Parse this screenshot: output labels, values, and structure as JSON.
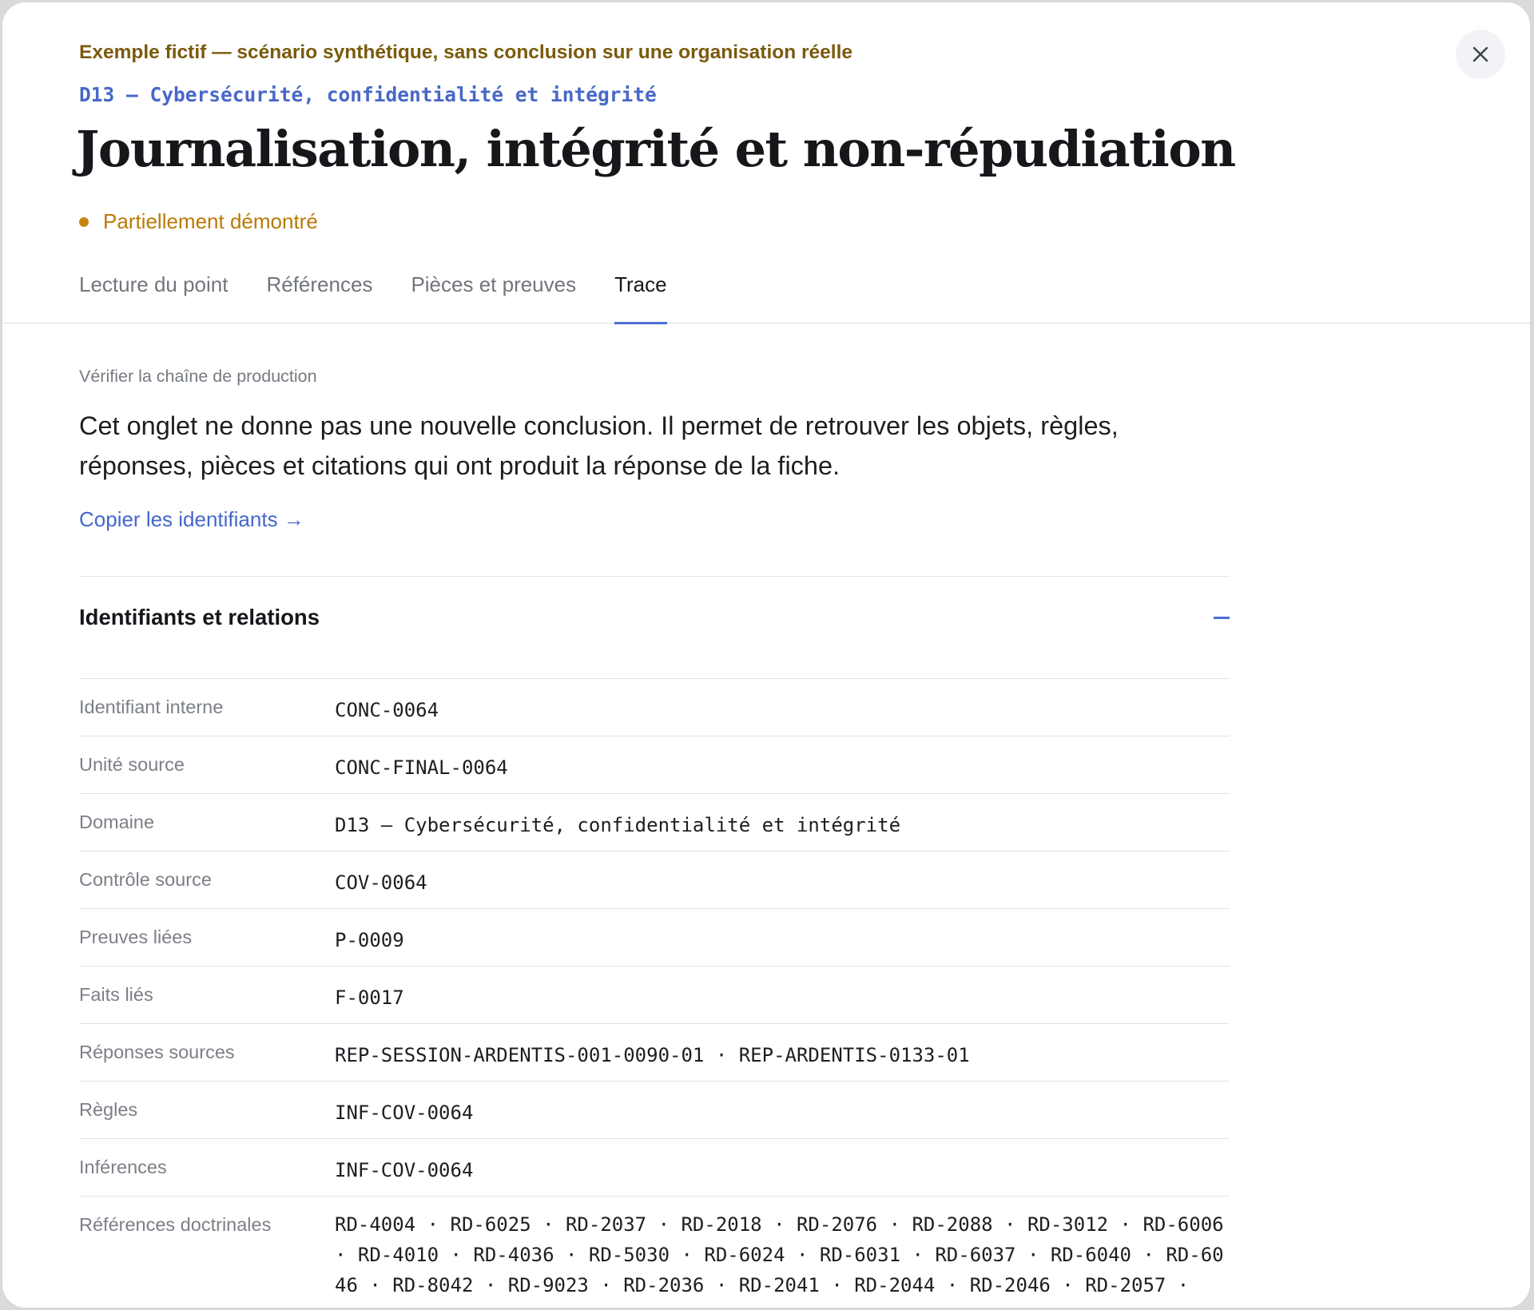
{
  "header": {
    "disclaimer": "Exemple fictif — scénario synthétique, sans conclusion sur une organisation réelle",
    "domain": "D13 — Cybersécurité, confidentialité et intégrité",
    "title": "Journalisation, intégrité et non-répudiation",
    "status": {
      "label": "Partiellement démontré",
      "color": "#c5860f"
    },
    "close_icon": "close-icon"
  },
  "tabs": [
    {
      "label": "Lecture du point",
      "active": false
    },
    {
      "label": "Références",
      "active": false
    },
    {
      "label": "Pièces et preuves",
      "active": false
    },
    {
      "label": "Trace",
      "active": true
    }
  ],
  "trace": {
    "eyebrow": "Vérifier la chaîne de production",
    "intro": "Cet onglet ne donne pas une nouvelle conclusion. Il permet de retrouver les objets, règles, réponses, pièces et citations qui ont produit la réponse de la fiche.",
    "copy_link": "Copier les identifiants →",
    "accordion": {
      "title": "Identifiants et relations",
      "expanded": true,
      "toggle_icon": "minus-icon"
    },
    "rows": [
      {
        "label": "Identifiant interne",
        "value": "CONC-0064"
      },
      {
        "label": "Unité source",
        "value": "CONC-FINAL-0064"
      },
      {
        "label": "Domaine",
        "value": "D13 — Cybersécurité, confidentialité et intégrité"
      },
      {
        "label": "Contrôle source",
        "value": "COV-0064"
      },
      {
        "label": "Preuves liées",
        "value": "P-0009"
      },
      {
        "label": "Faits liés",
        "value": "F-0017"
      },
      {
        "label": "Réponses sources",
        "value": "REP-SESSION-ARDENTIS-001-0090-01 · REP-ARDENTIS-0133-01"
      },
      {
        "label": "Règles",
        "value": "INF-COV-0064"
      },
      {
        "label": "Inférences",
        "value": "INF-COV-0064"
      },
      {
        "label": "Références doctrinales",
        "value": "RD-4004 · RD-6025 · RD-2037 · RD-2018 · RD-2076 · RD-2088 · RD-3012 · RD-6006 · RD-4010 · RD-4036 · RD-5030 · RD-6024 · RD-6031 · RD-6037 · RD-6040 · RD-6046 · RD-8042 · RD-9023 · RD-2036 · RD-2041 · RD-2044 · RD-2046 · RD-2057 ·"
      }
    ]
  }
}
